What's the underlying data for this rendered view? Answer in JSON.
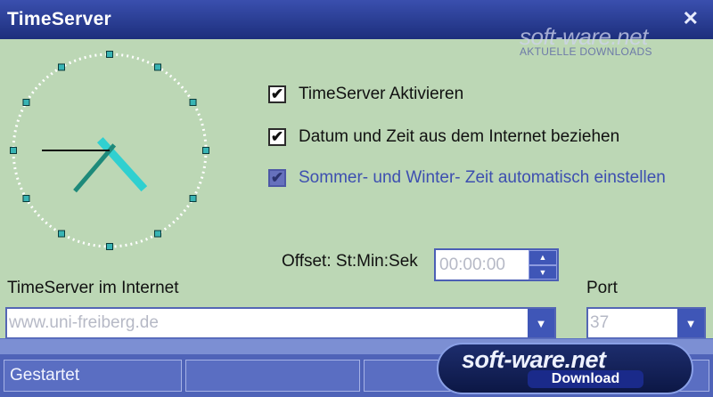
{
  "window": {
    "title": "TimeServer"
  },
  "watermark": {
    "brand": "soft-ware.net",
    "tagline": "AKTUELLE DOWNLOADS"
  },
  "options": [
    {
      "label": "TimeServer Aktivieren",
      "checked": true,
      "enabled": true
    },
    {
      "label": "Datum und Zeit aus dem Internet beziehen",
      "checked": true,
      "enabled": true
    },
    {
      "label": "Sommer- und Winter- Zeit automatisch einstellen",
      "checked": true,
      "enabled": false
    }
  ],
  "offset": {
    "label": "Offset: St:Min:Sek",
    "value": "00:00:00"
  },
  "server": {
    "label": "TimeServer im Internet",
    "value": "www.uni-freiberg.de"
  },
  "port": {
    "label": "Port",
    "value": "37"
  },
  "status": {
    "text": "Gestartet"
  },
  "badge": {
    "brand": "soft-ware.net",
    "action": "Download"
  },
  "clock": {
    "hours": 4,
    "minutes": 36,
    "seconds": 45
  },
  "colors": {
    "title_bar": "#1d2f7c",
    "background": "#bcd7b5",
    "clock_tick": "#38b4b4",
    "accent": "#4f63b8"
  }
}
